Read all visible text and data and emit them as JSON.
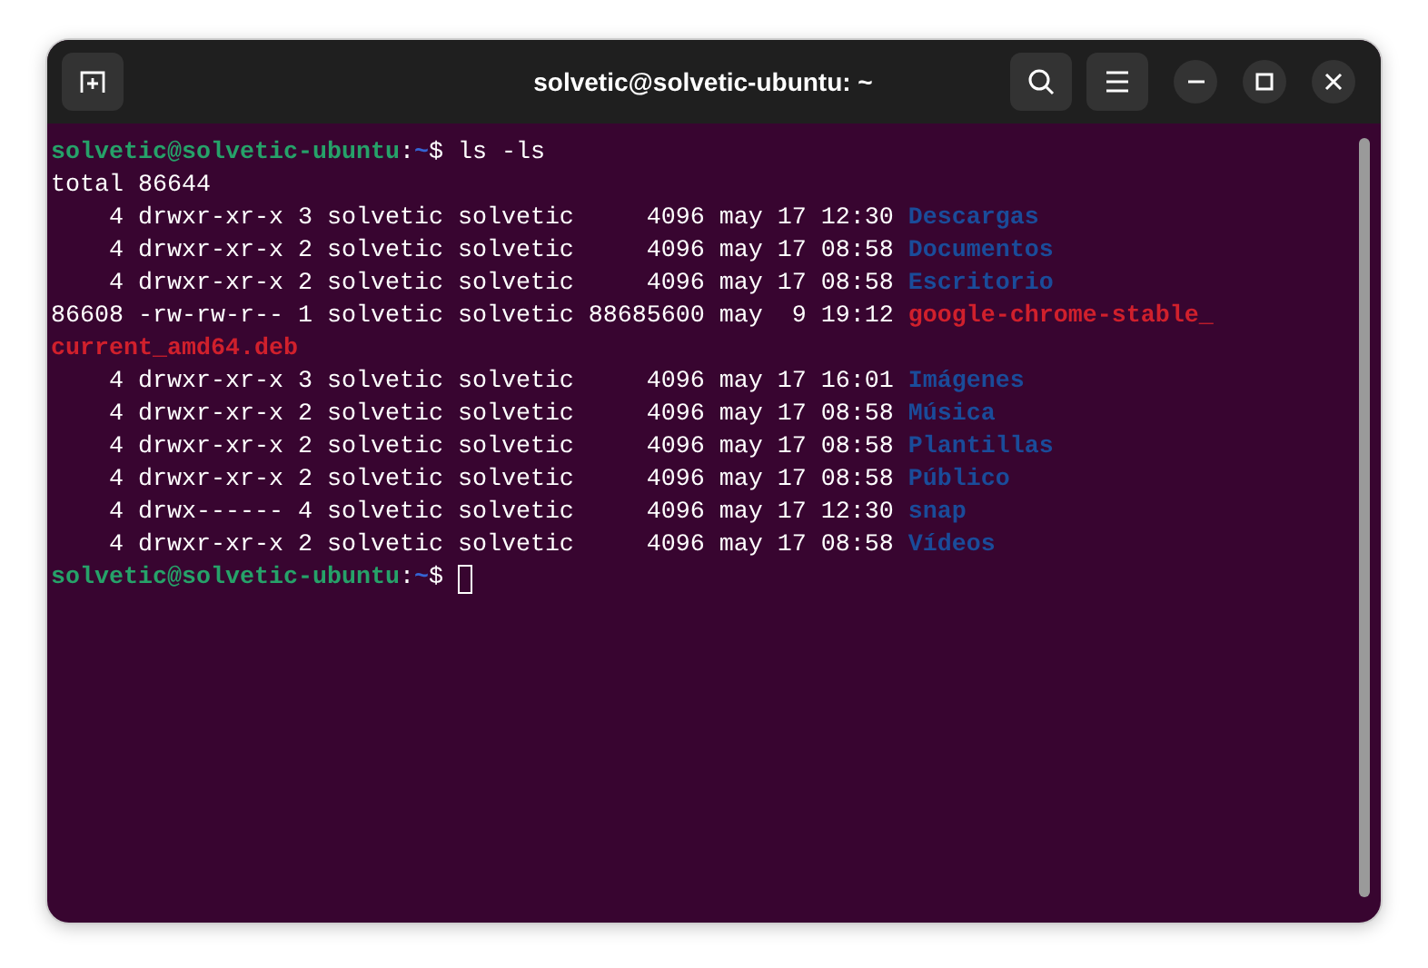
{
  "window": {
    "title": "solvetic@solvetic-ubuntu: ~"
  },
  "terminal": {
    "lines": [
      {
        "kind": "prompt",
        "user": "solvetic@solvetic-ubuntu",
        "separator": ":",
        "path": "~",
        "symbol": "$",
        "command": "ls -ls",
        "cursor": false
      },
      {
        "kind": "text",
        "text": "total 86644"
      },
      {
        "kind": "entry",
        "info": "    4 drwxr-xr-x 3 solvetic solvetic     4096 may 17 12:30",
        "name": "Descargas",
        "color": "#1a4c9a"
      },
      {
        "kind": "entry",
        "info": "    4 drwxr-xr-x 2 solvetic solvetic     4096 may 17 08:58",
        "name": "Documentos",
        "color": "#1a4c9a"
      },
      {
        "kind": "entry",
        "info": "    4 drwxr-xr-x 2 solvetic solvetic     4096 may 17 08:58",
        "name": "Escritorio",
        "color": "#1a4c9a"
      },
      {
        "kind": "entry",
        "info": "86608 -rw-rw-r-- 1 solvetic solvetic 88685600 may  9 19:12",
        "name": "google-chrome-stable_",
        "color": "#d0202c"
      },
      {
        "kind": "entry",
        "name": "current_amd64.deb",
        "color": "#d0202c"
      },
      {
        "kind": "entry",
        "info": "    4 drwxr-xr-x 3 solvetic solvetic     4096 may 17 16:01",
        "name": "Imágenes",
        "color": "#1a4c9a"
      },
      {
        "kind": "entry",
        "info": "    4 drwxr-xr-x 2 solvetic solvetic     4096 may 17 08:58",
        "name": "Música",
        "color": "#1a4c9a"
      },
      {
        "kind": "entry",
        "info": "    4 drwxr-xr-x 2 solvetic solvetic     4096 may 17 08:58",
        "name": "Plantillas",
        "color": "#1a4c9a"
      },
      {
        "kind": "entry",
        "info": "    4 drwxr-xr-x 2 solvetic solvetic     4096 may 17 08:58",
        "name": "Público",
        "color": "#1a4c9a"
      },
      {
        "kind": "entry",
        "info": "    4 drwx------ 4 solvetic solvetic     4096 may 17 12:30",
        "name": "snap",
        "color": "#1a4c9a"
      },
      {
        "kind": "entry",
        "info": "    4 drwxr-xr-x 2 solvetic solvetic     4096 may 17 08:58",
        "name": "Vídeos",
        "color": "#1a4c9a"
      },
      {
        "kind": "prompt",
        "user": "solvetic@solvetic-ubuntu",
        "separator": ":",
        "path": "~",
        "symbol": "$",
        "cursor": true
      }
    ]
  }
}
